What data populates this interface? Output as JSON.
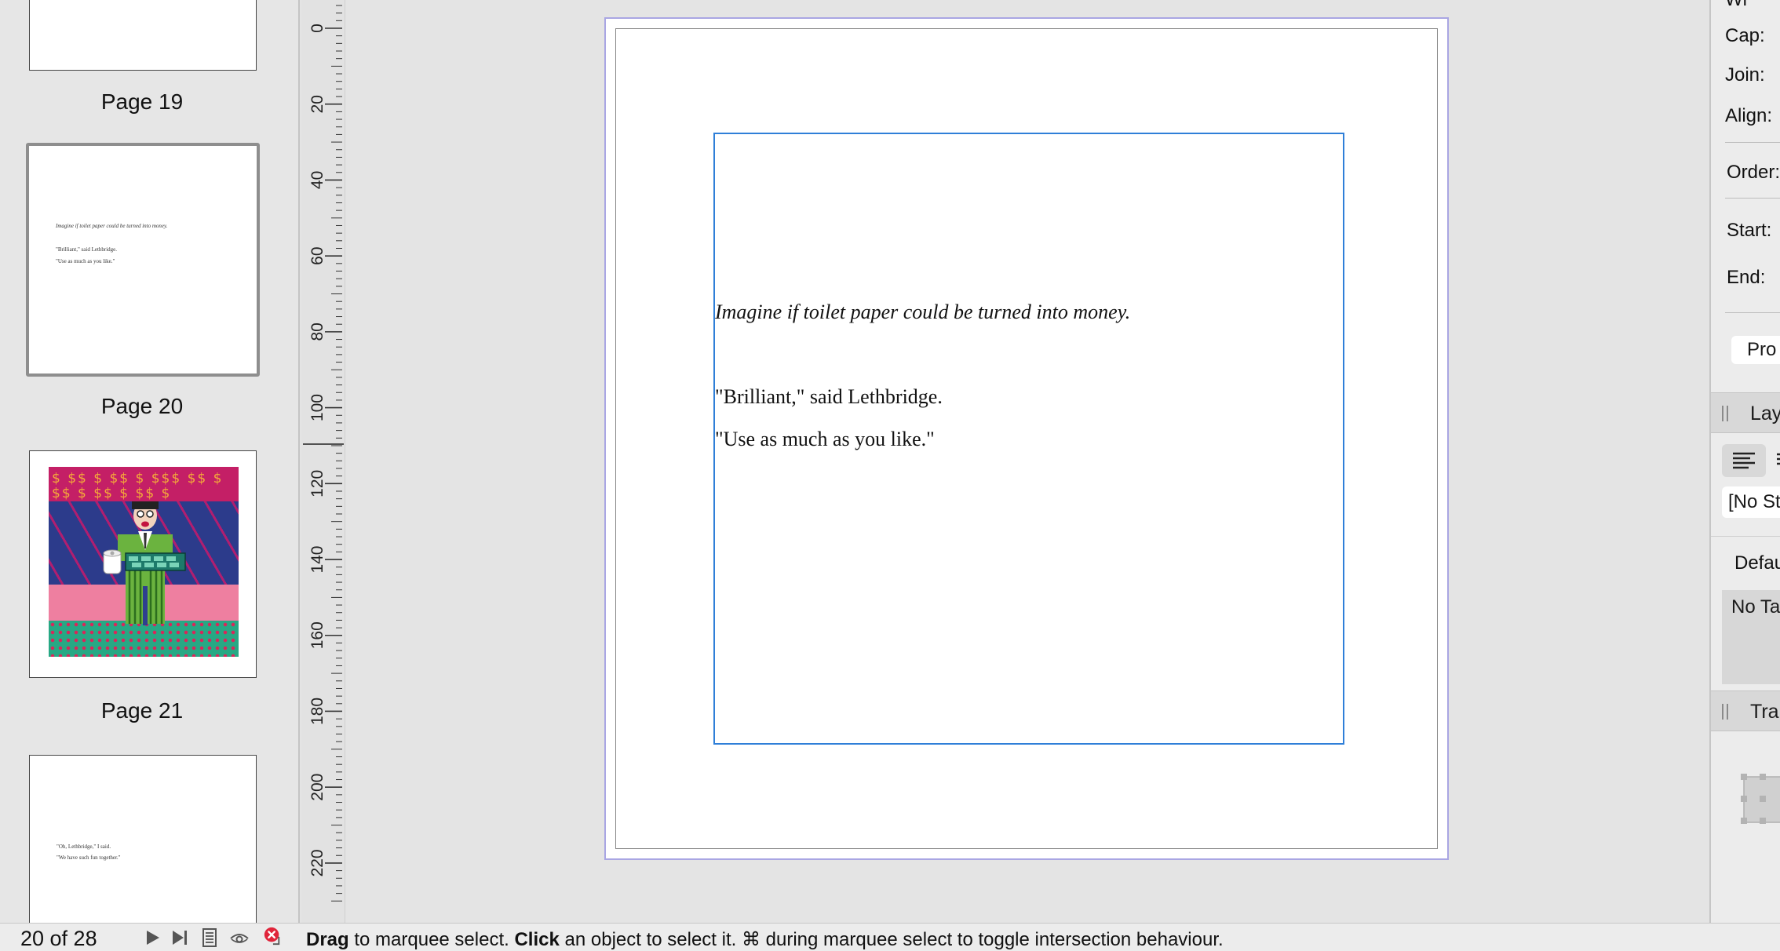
{
  "pages_panel": {
    "pages": [
      {
        "label": "Page 19"
      },
      {
        "label": "Page 20",
        "lines": [
          "Imagine if toilet paper could be turned into money.",
          "\"Brilliant,\" said Lethbridge.",
          "\"Use as much as you like.\""
        ]
      },
      {
        "label": "Page 21"
      },
      {
        "label": "Page 22",
        "lines": [
          "\"Oh, Lethbridge,\" I said.",
          "\"We have such fun together.\""
        ]
      }
    ],
    "dollar_pattern": "$ $$ $ $$ $ $$$ $$ $ $$ $ $$ $ $$ $"
  },
  "ruler": {
    "ticks": [
      "0",
      "20",
      "40",
      "60",
      "80",
      "100",
      "120",
      "140",
      "160",
      "180",
      "200",
      "220"
    ]
  },
  "document": {
    "lines": [
      "Imagine if toilet paper could be turned into money.",
      "\"Brilliant,\" said Lethbridge.",
      "\"Use as much as you like.\""
    ]
  },
  "inspector": {
    "labels": [
      "Cap:",
      "Join:",
      "Align:",
      "Order:",
      "Start:",
      "End:"
    ],
    "profile_button": "Pro",
    "layout_panel": "Lay",
    "style_select": "[No St",
    "tabs_label": "Defau",
    "tabs_list": "No Ta",
    "transform_panel": "Trar"
  },
  "status_bar": {
    "page_count": "20 of 28",
    "hint_drag": "Drag",
    "hint_1": " to marquee select. ",
    "hint_click": "Click",
    "hint_2": " an object to select it. ⌘ during marquee select to toggle intersection behaviour."
  },
  "colors": {
    "selection_frame": "#2f7fd8",
    "page_border": "#a9a6e3",
    "error_icon": "#e0243a"
  }
}
